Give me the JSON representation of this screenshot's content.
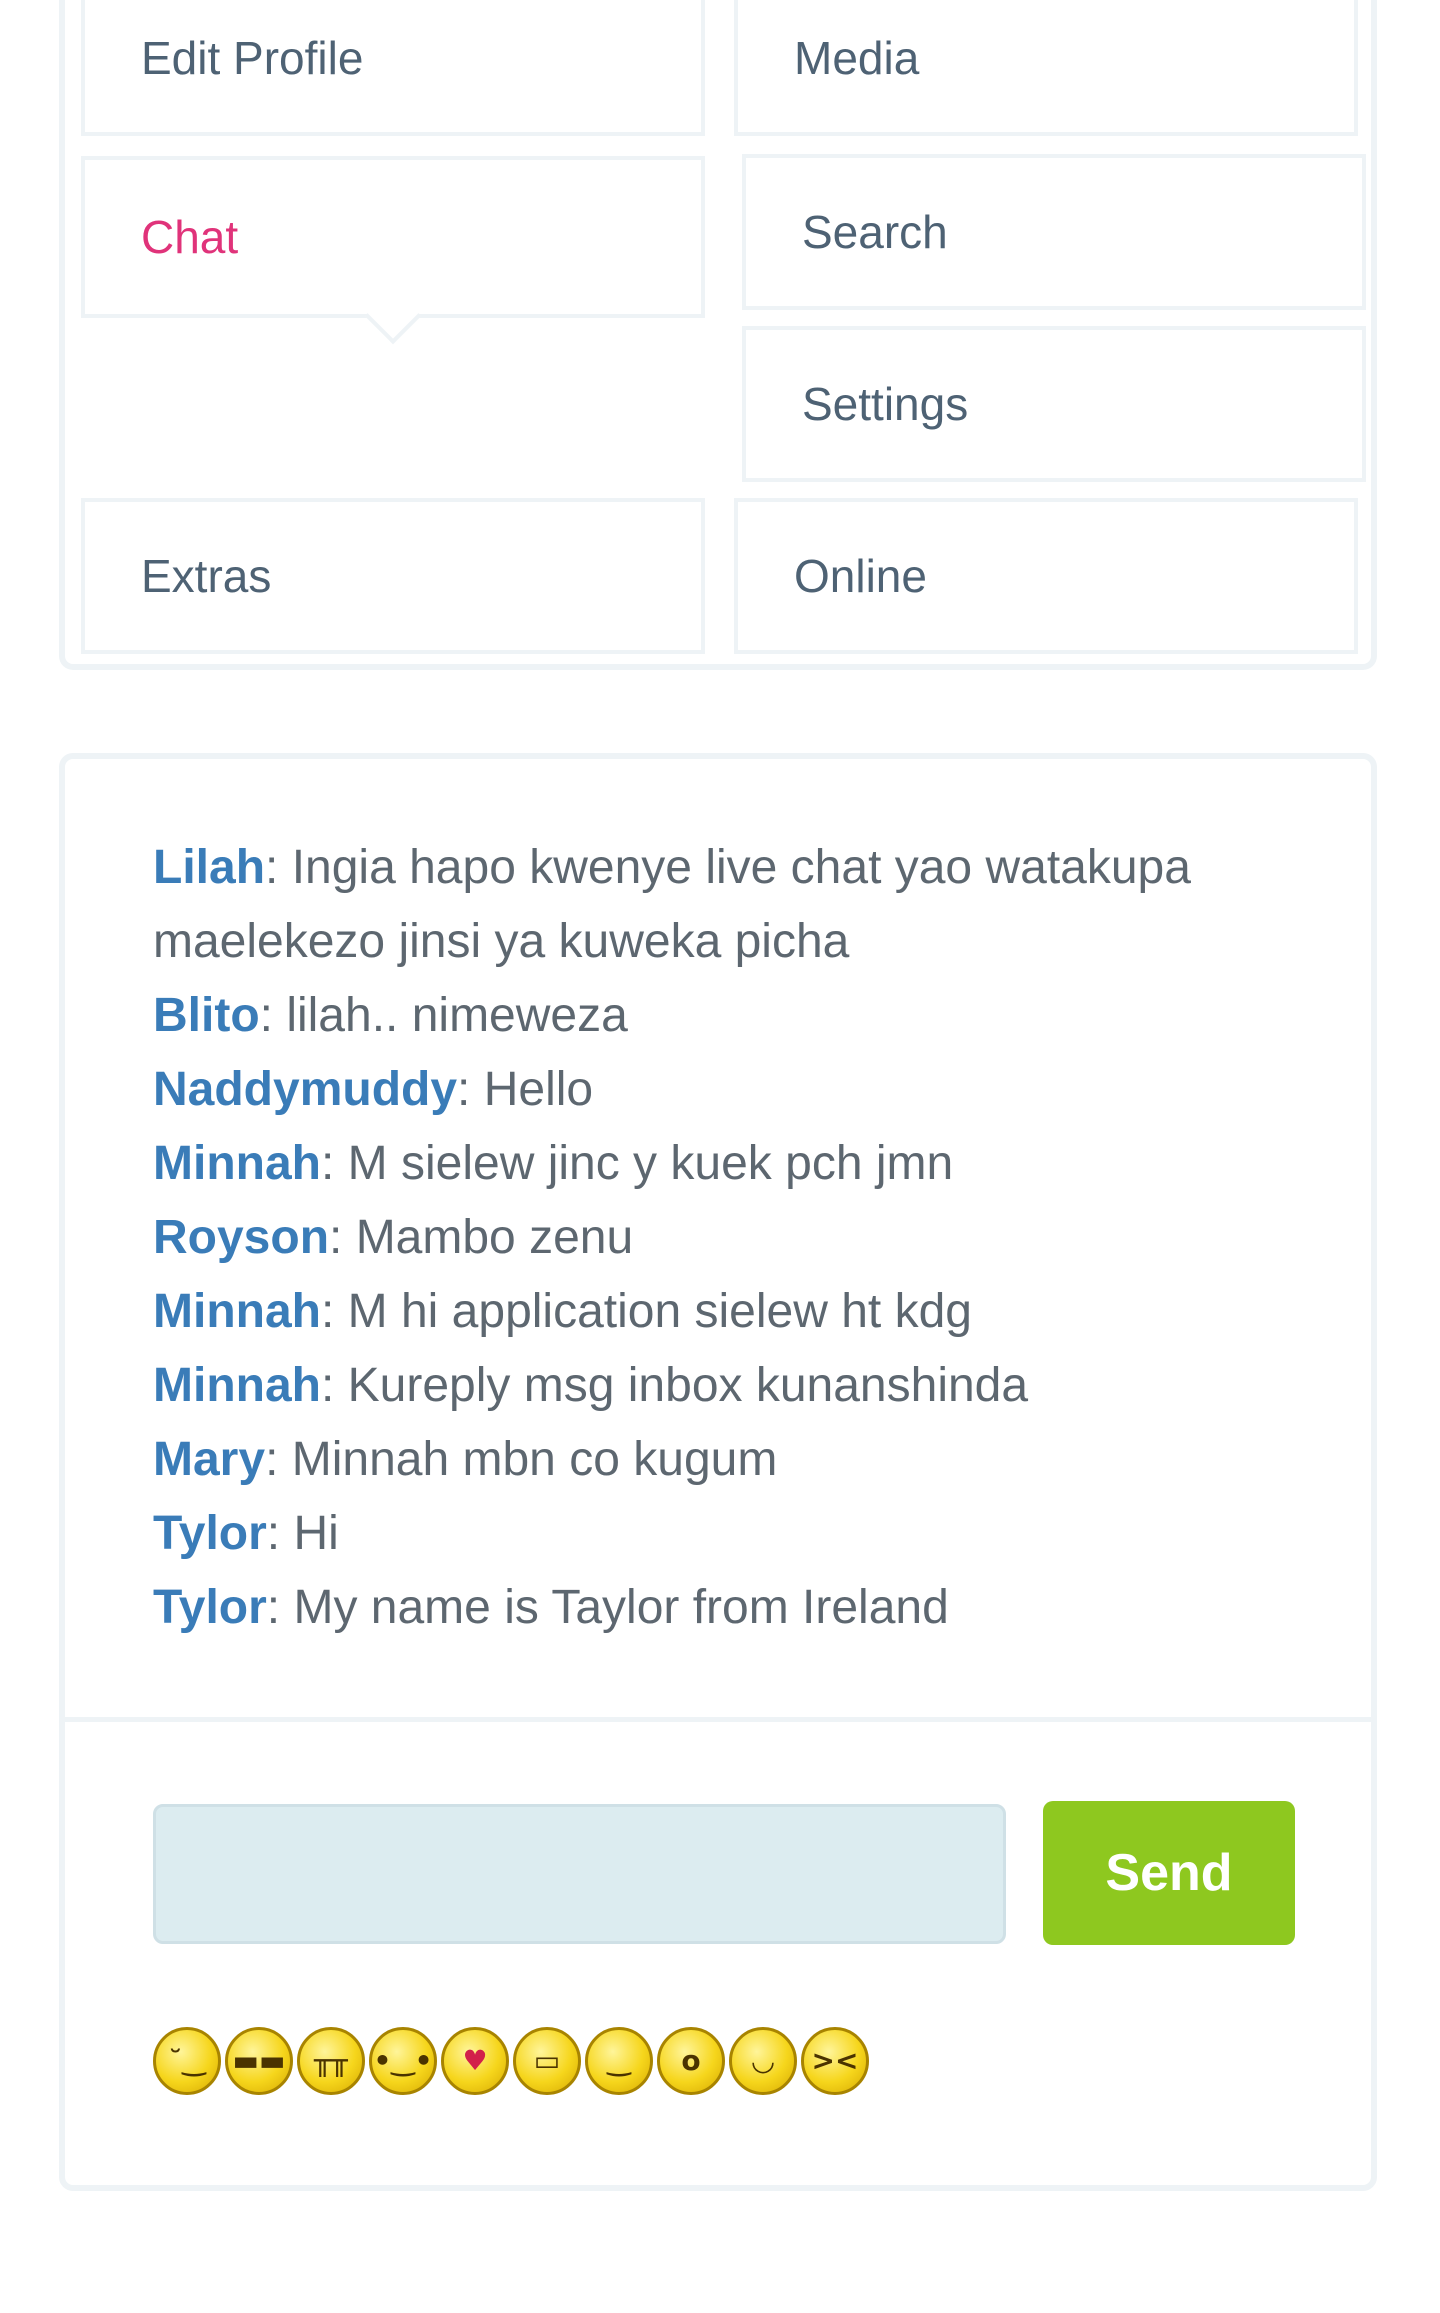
{
  "nav": {
    "items": [
      {
        "label": "Edit Profile"
      },
      {
        "label": "Media"
      },
      {
        "label": "Chat",
        "active": true
      },
      {
        "label": "Search"
      },
      {
        "label": "Settings"
      },
      {
        "label": "Extras"
      },
      {
        "label": "Online"
      }
    ]
  },
  "chat": {
    "messages": [
      {
        "user": "Lilah",
        "text": ": Ingia hapo kwenye live chat yao watakupa maelekezo jinsi ya kuweka picha"
      },
      {
        "user": "Blito",
        "text": ": lilah.. nimeweza"
      },
      {
        "user": "Naddymuddy",
        "text": ": Hello"
      },
      {
        "user": "Minnah",
        "text": ": M sielew jinc y kuek pch jmn"
      },
      {
        "user": "Royson",
        "text": ": Mambo zenu"
      },
      {
        "user": "Minnah",
        "text": ": M hi application sielew ht kdg"
      },
      {
        "user": "Minnah",
        "text": ": Kureply msg inbox kunanshinda"
      },
      {
        "user": "Mary",
        "text": ": Minnah mbn co kugum"
      },
      {
        "user": "Tylor",
        "text": ": Hi"
      },
      {
        "user": "Tylor",
        "text": ": My name is Taylor from Ireland"
      }
    ],
    "input_value": "",
    "send_label": "Send",
    "emojis": [
      {
        "name": "confused-emoji",
        "glyph": "˘‿"
      },
      {
        "name": "sunglasses-emoji",
        "glyph": "▬▬"
      },
      {
        "name": "crying-emoji",
        "glyph": "╥╥"
      },
      {
        "name": "blush-emoji",
        "glyph": "•‿•"
      },
      {
        "name": "kiss-emoji",
        "glyph": "♥"
      },
      {
        "name": "grin-emoji",
        "glyph": "▭"
      },
      {
        "name": "smile-emoji",
        "glyph": "‿"
      },
      {
        "name": "surprised-emoji",
        "glyph": "o"
      },
      {
        "name": "smirk-emoji",
        "glyph": "◡"
      },
      {
        "name": "laughing-emoji",
        "glyph": "><"
      }
    ]
  },
  "colors": {
    "accent_pink": "#e0337a",
    "username_blue": "#3a7cb8",
    "send_green": "#8ec81f"
  }
}
